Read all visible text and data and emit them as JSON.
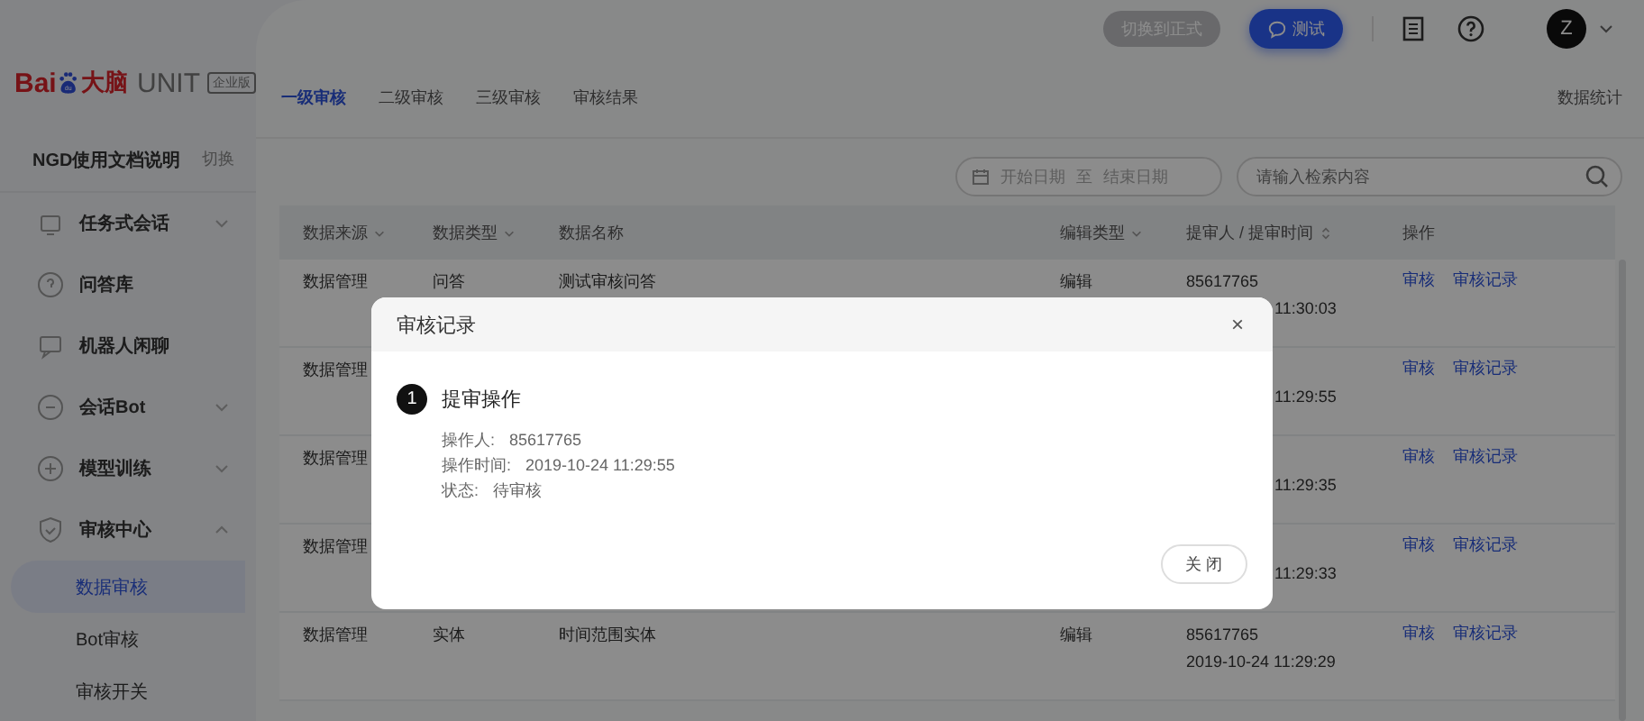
{
  "logo": {
    "bai": "Bai",
    "du": "du",
    "brain": "大脑",
    "unit": "UNIT",
    "edition": "企业版"
  },
  "sidebar": {
    "project": "NGD使用文档说明",
    "switch": "切换",
    "items": [
      {
        "label": "任务式会话",
        "expanded": false,
        "has_arrow": true
      },
      {
        "label": "问答库",
        "has_arrow": false
      },
      {
        "label": "机器人闲聊",
        "has_arrow": false
      },
      {
        "label": "会话Bot",
        "expanded": false,
        "has_arrow": true
      },
      {
        "label": "模型训练",
        "expanded": false,
        "has_arrow": true
      },
      {
        "label": "审核中心",
        "expanded": true,
        "has_arrow": true,
        "children": [
          {
            "label": "数据审核",
            "selected": true
          },
          {
            "label": "Bot审核",
            "selected": false
          },
          {
            "label": "审核开关",
            "selected": false
          }
        ]
      }
    ]
  },
  "topbar": {
    "formal_button": "切换到正式",
    "test_button": "测试",
    "avatar": "Z"
  },
  "tabs": [
    {
      "label": "一级审核",
      "selected": true
    },
    {
      "label": "二级审核",
      "selected": false
    },
    {
      "label": "三级审核",
      "selected": false
    },
    {
      "label": "审核结果",
      "selected": false
    }
  ],
  "stats_link": "数据统计",
  "filters": {
    "start_date": {
      "placeholder": "开始日期"
    },
    "date_separator": "至",
    "end_date": {
      "placeholder": "结束日期"
    },
    "search": {
      "placeholder": "请输入检索内容"
    }
  },
  "table": {
    "columns": [
      "数据来源",
      "数据类型",
      "数据名称",
      "编辑类型",
      "提审人 / 提审时间",
      "操作"
    ],
    "rows": [
      {
        "source": "数据管理",
        "type": "问答",
        "name": "测试审核问答",
        "edit": "编辑",
        "submitter": "85617765",
        "time": "11:30:03",
        "covered": true,
        "actions": [
          "审核",
          "审核记录"
        ]
      },
      {
        "source": "数据管理",
        "time": "11:29:55",
        "covered": true,
        "actions": [
          "审核",
          "审核记录"
        ]
      },
      {
        "source": "数据管理",
        "time": "11:29:35",
        "covered": true,
        "actions": [
          "审核",
          "审核记录"
        ]
      },
      {
        "source": "数据管理",
        "time": "11:29:33",
        "covered": true,
        "actions": [
          "审核",
          "审核记录"
        ]
      },
      {
        "source": "数据管理",
        "type": "实体",
        "name": "时间范围实体",
        "edit": "编辑",
        "submitter": "85617765",
        "time": "2019-10-24 11:29:29",
        "actions": [
          "审核",
          "审核记录"
        ]
      }
    ]
  },
  "dialog": {
    "title": "审核记录",
    "close": "×",
    "step": {
      "number": "1",
      "title": "提审操作",
      "details": [
        {
          "label": "操作人:",
          "value": "85617765"
        },
        {
          "label": "操作时间:",
          "value": "2019-10-24 11:29:55"
        },
        {
          "label": "状态:",
          "value": "待审核"
        }
      ]
    },
    "button": "关 闭"
  }
}
